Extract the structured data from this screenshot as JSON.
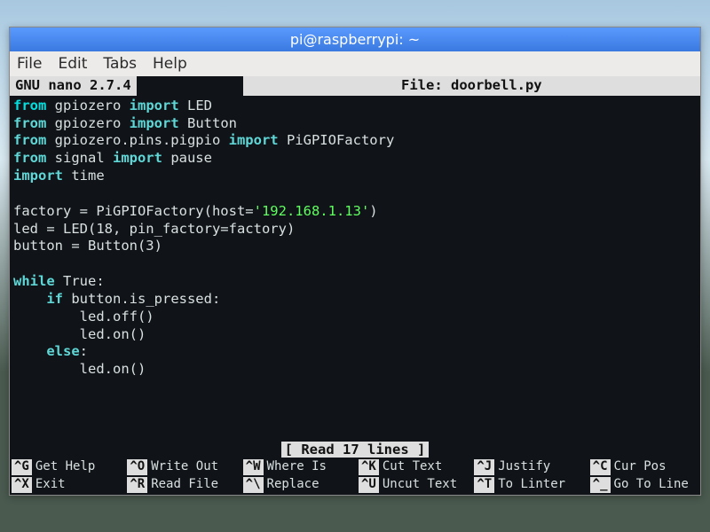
{
  "titlebar": "pi@raspberrypi: ~",
  "menu": {
    "file": "File",
    "edit": "Edit",
    "tabs": "Tabs",
    "help": "Help"
  },
  "nano": {
    "version": "GNU nano 2.7.4",
    "file_label": "File: doorbell.py",
    "status": "[ Read 17 lines ]"
  },
  "code": {
    "l1a": "from",
    "l1b": " gpiozero ",
    "l1c": "import",
    "l1d": " LED",
    "l2a": "from",
    "l2b": " gpiozero ",
    "l2c": "import",
    "l2d": " Button",
    "l3a": "from",
    "l3b": " gpiozero.pins.pigpio ",
    "l3c": "import",
    "l3d": " PiGPIOFactory",
    "l4a": "from",
    "l4b": " signal ",
    "l4c": "import",
    "l4d": " pause",
    "l5a": "import",
    "l5b": " time",
    "blank": " ",
    "l6a": "factory = PiGPIOFactory(host=",
    "l6b": "'192.168.1.13'",
    "l6c": ")",
    "l7": "led = LED(18, pin_factory=factory)",
    "l8": "button = Button(3)",
    "l9a": "while",
    "l9b": " True:",
    "l10a": "    ",
    "l10b": "if",
    "l10c": " button.is_pressed:",
    "l11": "        led.off()",
    "l12": "        led.on()",
    "l13a": "    ",
    "l13b": "else",
    "l13c": ":",
    "l14": "        led.on()"
  },
  "shortcuts": {
    "r1c1k": "^G",
    "r1c1t": "Get Help",
    "r1c2k": "^O",
    "r1c2t": "Write Out",
    "r1c3k": "^W",
    "r1c3t": "Where Is",
    "r1c4k": "^K",
    "r1c4t": "Cut Text",
    "r1c5k": "^J",
    "r1c5t": "Justify",
    "r1c6k": "^C",
    "r1c6t": "Cur Pos",
    "r2c1k": "^X",
    "r2c1t": "Exit",
    "r2c2k": "^R",
    "r2c2t": "Read File",
    "r2c3k": "^\\",
    "r2c3t": "Replace",
    "r2c4k": "^U",
    "r2c4t": "Uncut Text",
    "r2c5k": "^T",
    "r2c5t": "To Linter",
    "r2c6k": "^_",
    "r2c6t": "Go To Line"
  }
}
